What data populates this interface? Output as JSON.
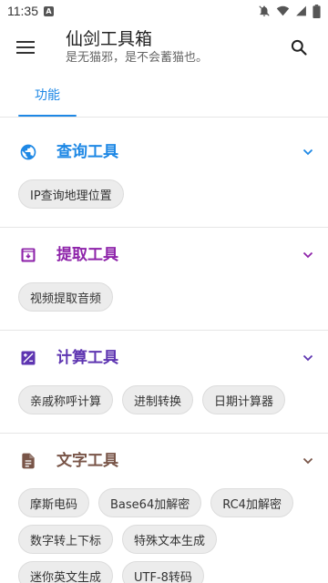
{
  "status_bar": {
    "time": "11:35",
    "notif_icon": "A"
  },
  "app_bar": {
    "title": "仙剑工具箱",
    "subtitle": "是无猫邪，是不会蓄猫也。"
  },
  "tabs": [
    {
      "label": "功能"
    }
  ],
  "colors": {
    "accent": "#1e88e5",
    "query": "#1e88e5",
    "extract": "#8e24aa",
    "calc": "#5e35b1",
    "text": "#795548"
  },
  "sections": [
    {
      "title": "查询工具",
      "icon": "globe-icon",
      "chips": [
        "IP查询地理位置"
      ]
    },
    {
      "title": "提取工具",
      "icon": "archive-box-icon",
      "chips": [
        "视频提取音频"
      ]
    },
    {
      "title": "计算工具",
      "icon": "calculator-icon",
      "chips": [
        "亲戚称呼计算",
        "进制转换",
        "日期计算器"
      ]
    },
    {
      "title": "文字工具",
      "icon": "document-icon",
      "chips": [
        "摩斯电码",
        "Base64加解密",
        "RC4加解密",
        "数字转上下标",
        "特殊文本生成",
        "迷你英文生成",
        "UTF-8转码"
      ]
    }
  ]
}
